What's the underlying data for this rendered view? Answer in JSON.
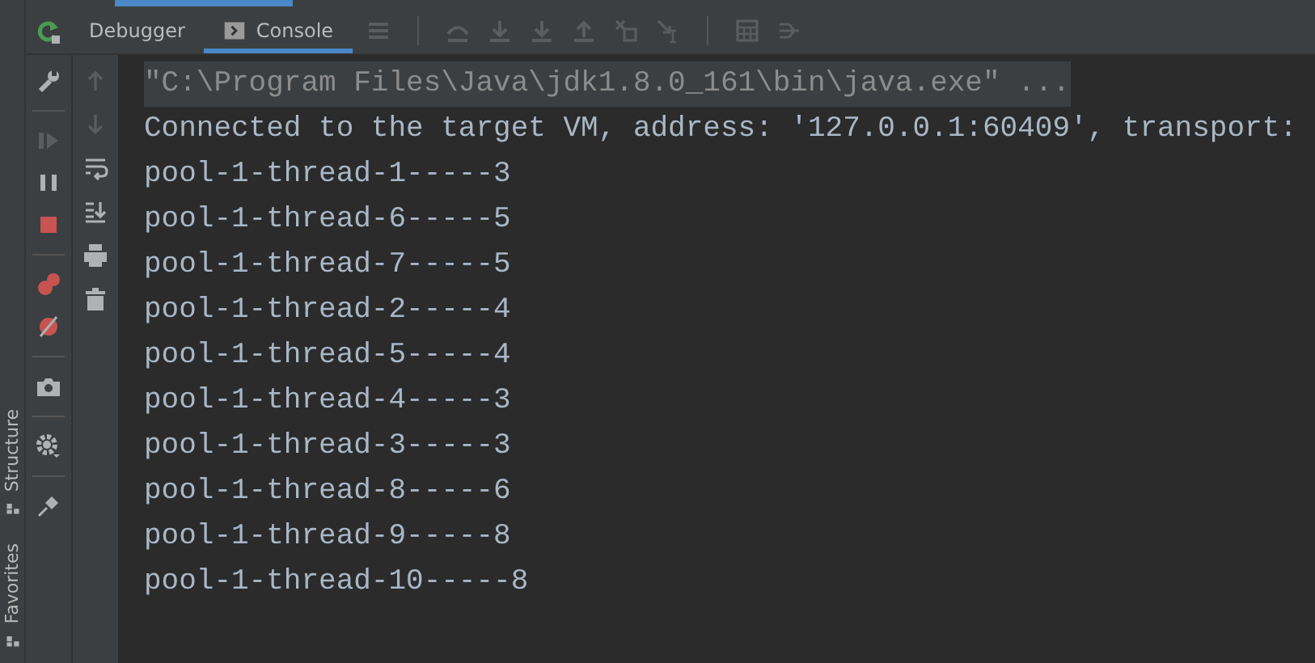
{
  "tabs": [
    {
      "label": "Debugger",
      "selected": false,
      "kind": "plain"
    },
    {
      "label": "Console",
      "selected": true,
      "kind": "console"
    }
  ],
  "side_tabs": [
    "Structure",
    "Favorites"
  ],
  "console": {
    "lines": [
      {
        "kind": "command",
        "text": "\"C:\\Program Files\\Java\\jdk1.8.0_161\\bin\\java.exe\" ..."
      },
      {
        "kind": "output",
        "text": "Connected to the target VM, address: '127.0.0.1:60409', transport:"
      },
      {
        "kind": "output",
        "text": "pool-1-thread-1-----3"
      },
      {
        "kind": "output",
        "text": "pool-1-thread-6-----5"
      },
      {
        "kind": "output",
        "text": "pool-1-thread-7-----5"
      },
      {
        "kind": "output",
        "text": "pool-1-thread-2-----4"
      },
      {
        "kind": "output",
        "text": "pool-1-thread-5-----4"
      },
      {
        "kind": "output",
        "text": "pool-1-thread-4-----3"
      },
      {
        "kind": "output",
        "text": "pool-1-thread-3-----3"
      },
      {
        "kind": "output",
        "text": "pool-1-thread-8-----6"
      },
      {
        "kind": "output",
        "text": "pool-1-thread-9-----8"
      },
      {
        "kind": "output",
        "text": "pool-1-thread-10-----8"
      }
    ]
  }
}
